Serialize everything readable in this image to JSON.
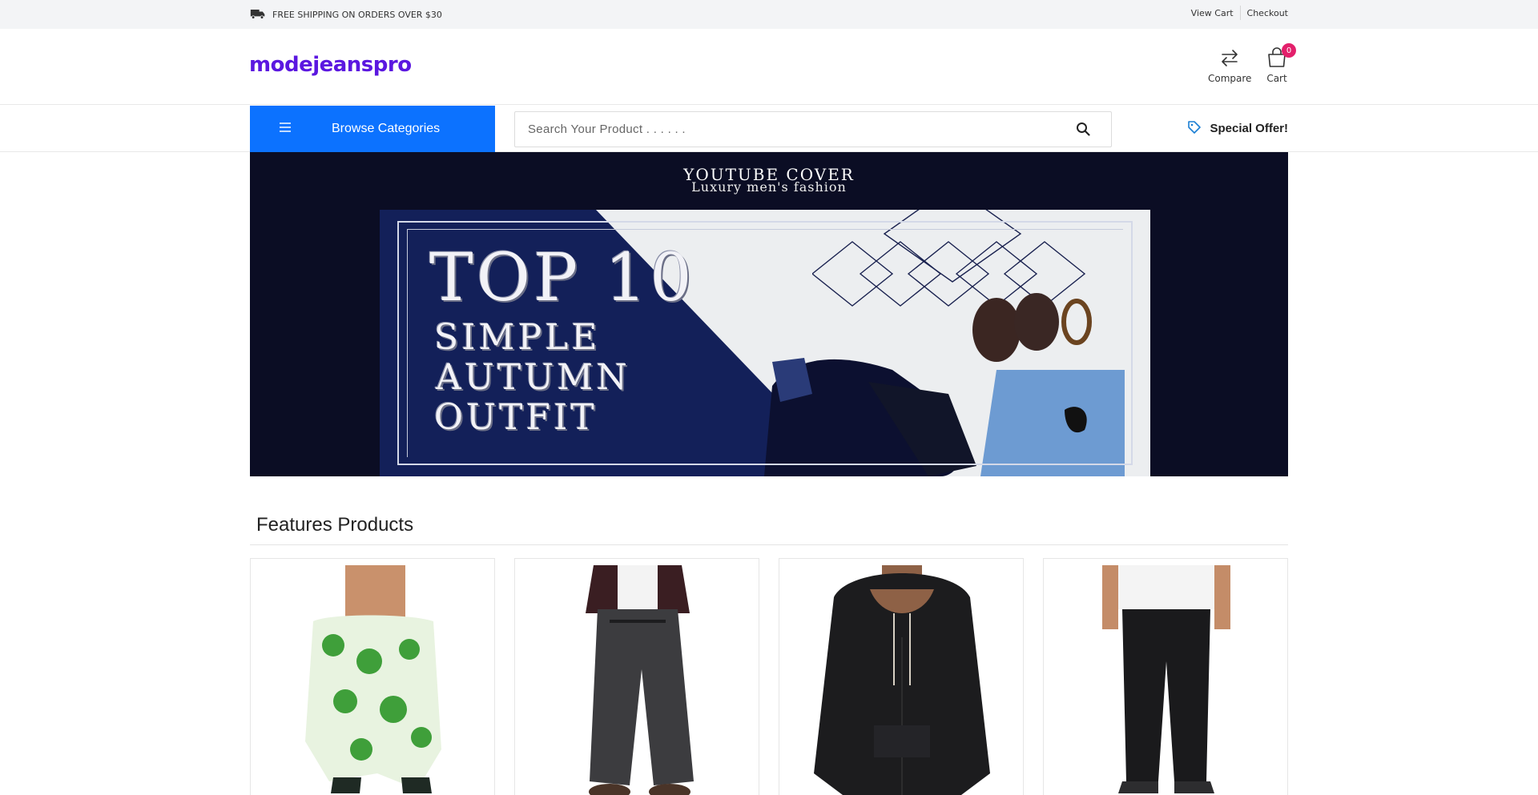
{
  "topbar": {
    "shipping_text": "FREE SHIPPING ON ORDERS OVER $30",
    "links": [
      "View Cart",
      "Checkout"
    ]
  },
  "header": {
    "logo": "modejeanspro",
    "compare_label": "Compare",
    "cart_label": "Cart",
    "cart_count": "0"
  },
  "nav": {
    "browse_label": "Browse Categories",
    "search_placeholder": "Search Your Product . . . . . .",
    "special_offer": "Special Offer!"
  },
  "hero": {
    "cover_title": "YOUTUBE COVER",
    "cover_subtitle": "Luxury men's fashion",
    "line1": "TOP 10",
    "line2": "SIMPLE",
    "line3": "AUTUMN",
    "line4": "OUTFIT"
  },
  "section": {
    "title": "Features Products"
  },
  "products": [
    {
      "image": "green-tropical-sarong-product-image"
    },
    {
      "image": "black-wide-jeans-product-image"
    },
    {
      "image": "black-hooded-cardigan-product-image"
    },
    {
      "image": "black-chino-pants-product-image"
    }
  ],
  "colors": {
    "brand": "#5b17e0",
    "browse_bg": "#0c72ff",
    "badge": "#e3206b",
    "topbar_bg": "#f3f4f6",
    "hero_bg": "#0b0d24",
    "navy": "#132059"
  }
}
